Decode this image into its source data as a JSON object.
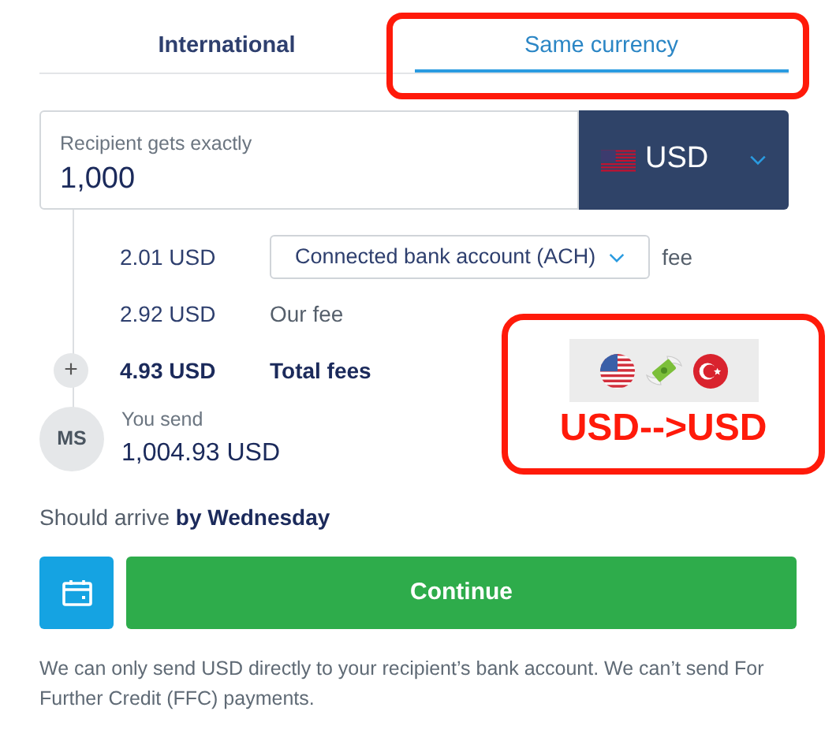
{
  "tabs": [
    {
      "label": "International",
      "selected": false
    },
    {
      "label": "Same currency",
      "selected": true
    }
  ],
  "recipient_field": {
    "label": "Recipient gets exactly",
    "value": "1,000"
  },
  "currency": {
    "code": "USD"
  },
  "fees": [
    {
      "kind": "method",
      "amount": "2.01 USD",
      "method": "Connected bank account (ACH)",
      "suffix": "fee"
    },
    {
      "kind": "plain",
      "amount": "2.92 USD",
      "label": "Our fee"
    },
    {
      "kind": "total",
      "amount": "4.93 USD",
      "label": "Total fees",
      "toggle": "+"
    }
  ],
  "you_send": {
    "initials": "MS",
    "label": "You send",
    "amount": "1,004.93 USD"
  },
  "arrival": {
    "prefix": "Should arrive",
    "day": "by Wednesday"
  },
  "continue_button": "Continue",
  "note": "We can only send USD directly to your recipient’s bank account. We can’t send For Further Credit (FFC) payments.",
  "annotation": {
    "caption": "USD-->USD"
  }
}
